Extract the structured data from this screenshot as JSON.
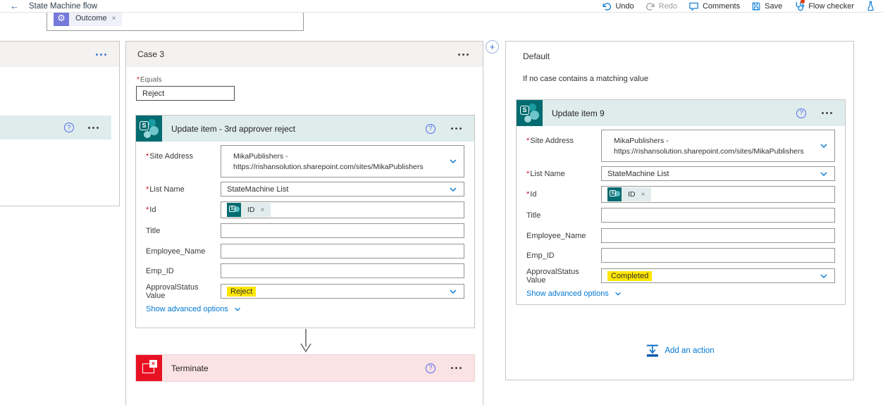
{
  "topbar": {
    "title": "State Machine flow",
    "undo": "Undo",
    "redo": "Redo",
    "comments": "Comments",
    "save": "Save",
    "flow_checker": "Flow checker"
  },
  "switch_fragment": {
    "outcome_token": "Outcome"
  },
  "case3": {
    "title": "Case 3",
    "equals_label": "Equals",
    "equals_value": "Reject"
  },
  "update_item_reject": {
    "title": "Update item - 3rd approver reject",
    "site_address_label": "Site Address",
    "site_address_line1": "MikaPublishers -",
    "site_address_line2": "https://rishansolution.sharepoint.com/sites/MikaPublishers",
    "list_name_label": "List Name",
    "list_name_value": "StateMachine List",
    "id_label": "Id",
    "id_token": "ID",
    "title_label": "Title",
    "employee_name_label": "Employee_Name",
    "emp_id_label": "Emp_ID",
    "approval_status_label": "ApprovalStatus Value",
    "approval_status_value": "Reject",
    "show_advanced": "Show advanced options"
  },
  "terminate": {
    "title": "Terminate"
  },
  "default_branch": {
    "title": "Default",
    "subtitle": "If no case contains a matching value",
    "add_action": "Add an action"
  },
  "update_item_9": {
    "title": "Update item 9",
    "site_address_label": "Site Address",
    "site_address_line1": "MikaPublishers -",
    "site_address_line2": "https://rishansolution.sharepoint.com/sites/MikaPublishers",
    "list_name_label": "List Name",
    "list_name_value": "StateMachine List",
    "id_label": "Id",
    "id_token": "ID",
    "title_label": "Title",
    "employee_name_label": "Employee_Name",
    "emp_id_label": "Emp_ID",
    "approval_status_label": "ApprovalStatus Value",
    "approval_status_value": "Completed",
    "show_advanced": "Show advanced options"
  },
  "icons": {
    "back": "←",
    "help": "?",
    "close": "×",
    "plus": "+",
    "approvals_gear": "⚙",
    "sharepoint_letter": "S",
    "terminate_x": "×"
  },
  "misc": {
    "required_marker": "*"
  },
  "colors": {
    "accent_blue": "#0078d4",
    "sharepoint_teal": "#036c70",
    "sharepoint_header": "#dfecec",
    "terminate_red": "#e81123",
    "terminate_header": "#fbe2e4",
    "highlight_yellow": "#ffe600",
    "flow_checker_badge": "#d83b01"
  }
}
